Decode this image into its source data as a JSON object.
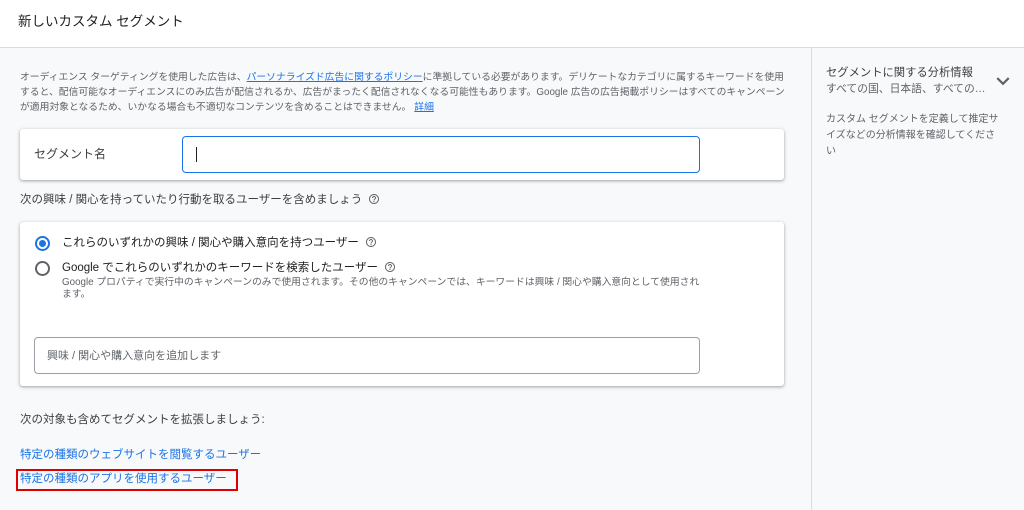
{
  "header": {
    "title": "新しいカスタム セグメント"
  },
  "policy": {
    "text_before_link": "オーディエンス ターゲティングを使用した広告は、",
    "policy_link": "パーソナライズド広告に関するポリシー",
    "text_after_link": "に準拠している必要があります。デリケートなカテゴリに属するキーワードを使用すると、配信可能なオーディエンスにのみ広告が配信されるか、広告がまったく配信されなくなる可能性もあります。Google 広告の広告掲載ポリシーはすべてのキャンペーンが適用対象となるため、いかなる場合も不適切なコンテンツを含めることはできません。",
    "details_link": "詳細"
  },
  "segment_name": {
    "label": "セグメント名"
  },
  "include_section": {
    "heading": "次の興味 / 関心を持っていたり行動を取るユーザーを含めましょう",
    "options": [
      {
        "label": "これらのいずれかの興味 / 関心や購入意向を持つユーザー",
        "selected": true
      },
      {
        "label": "Google でこれらのいずれかのキーワードを検索したユーザー",
        "description": "Google プロパティで実行中のキャンペーンのみで使用されます。その他のキャンペーンでは、キーワードは興味 / 関心や購入意向として使用されます。",
        "selected": false
      }
    ],
    "input_placeholder": "興味 / 関心や購入意向を追加します"
  },
  "expand_section": {
    "heading": "次の対象も含めてセグメントを拡張しましょう:",
    "links": [
      "特定の種類のウェブサイトを閲覧するユーザー",
      "特定の種類のアプリを使用するユーザー"
    ]
  },
  "insights_panel": {
    "title": "セグメントに関する分析情報",
    "subtitle": "すべての国、日本語、すべての…",
    "description": "カスタム セグメントを定義して推定サイズなどの分析情報を確認してください"
  },
  "icons": {
    "help": "help-outline-icon",
    "insights_toggle": "chevron-down-icon"
  },
  "colors": {
    "accent": "#1a73e8",
    "text-strong": "#202124",
    "text-primary": "#3c4043",
    "text-secondary": "#5f6368",
    "divider": "#dadce0",
    "surface": "#f8f9fa",
    "annotation": "#e00000"
  }
}
